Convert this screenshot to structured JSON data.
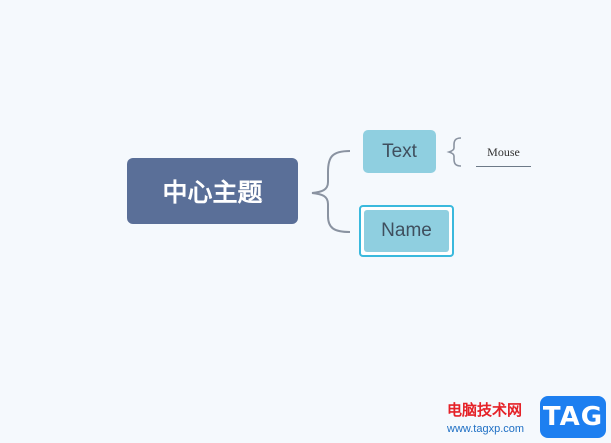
{
  "mindmap": {
    "central_topic": "中心主题",
    "subtopics": [
      {
        "label": "Text",
        "children": [
          "Mouse"
        ]
      },
      {
        "label": "Name",
        "selected": true,
        "children": []
      }
    ]
  },
  "watermark": {
    "site_name": "电脑技术网",
    "url": "www.tagxp.com",
    "logo_text": "TAG"
  },
  "colors": {
    "background": "#f5f9fd",
    "central_fill": "#5a6f98",
    "subtopic_fill": "#8fcfe0",
    "selection_border": "#3ab9dd",
    "connector": "#8a93a1"
  }
}
